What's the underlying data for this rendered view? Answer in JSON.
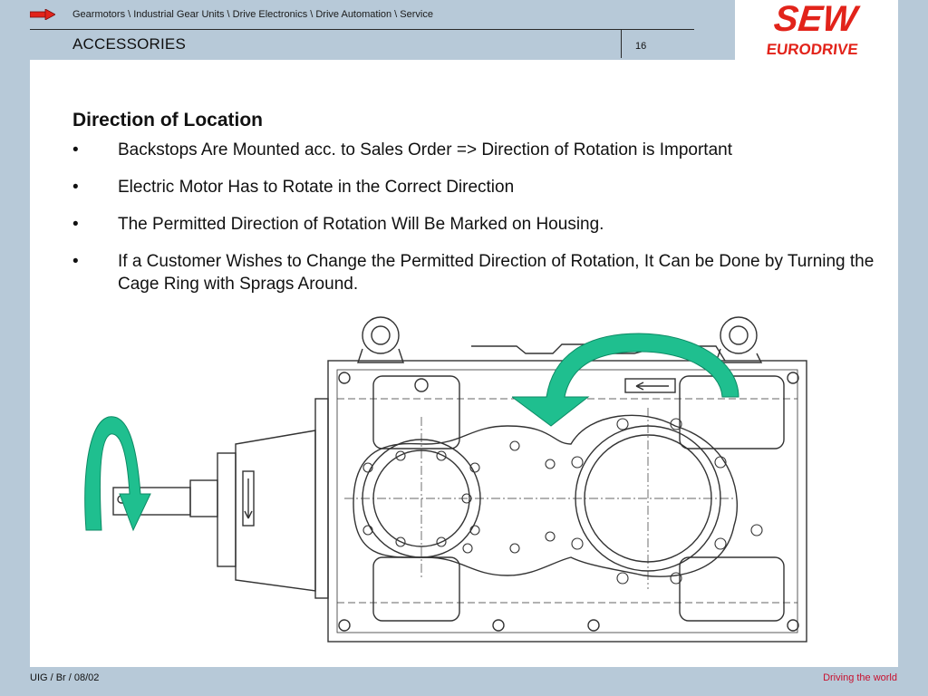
{
  "header": {
    "breadcrumb": "Gearmotors \\ Industrial Gear Units \\ Drive Electronics \\ Drive Automation \\ Service",
    "section_title": "ACCESSORIES",
    "page_number": "16"
  },
  "logo": {
    "line1": "SEW",
    "line2": "EURODRIVE"
  },
  "content": {
    "heading": "Direction of Location",
    "bullet_symbol": "•",
    "bullets": [
      "Backstops Are Mounted acc. to Sales Order => Direction of Rotation is Important",
      "Electric Motor Has to Rotate in the Correct Direction",
      "The Permitted Direction of Rotation Will Be Marked on Housing.",
      "If a Customer Wishes to Change the Permitted Direction of Rotation, It Can be Done by Turning the Cage Ring with Sprags Around."
    ]
  },
  "footer": {
    "left": "UIG / Br / 08/02",
    "right": "Driving the world"
  },
  "colors": {
    "background": "#b7c9d8",
    "arrow_green": "#1fbf8f",
    "brand_red": "#c8102e"
  }
}
